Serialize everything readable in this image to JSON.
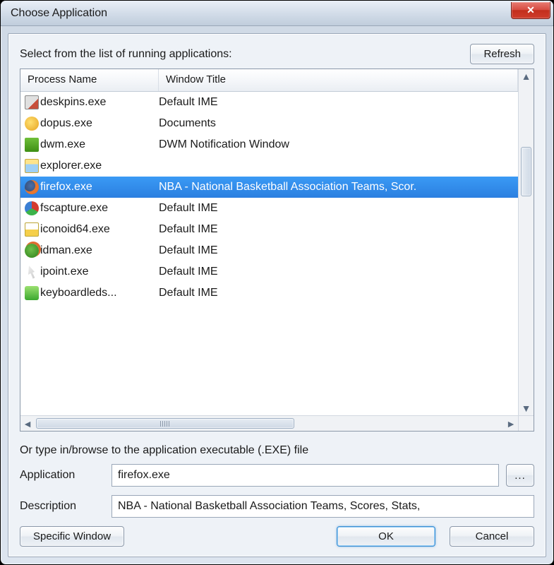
{
  "window": {
    "title": "Choose Application"
  },
  "instructions": {
    "top": "Select from the list of running applications:",
    "bottom": "Or type in/browse to the application executable (.EXE) file"
  },
  "buttons": {
    "refresh": "Refresh",
    "browse": "...",
    "specific_window": "Specific Window",
    "ok": "OK",
    "cancel": "Cancel",
    "close": "✕"
  },
  "columns": {
    "process": "Process Name",
    "title": "Window Title"
  },
  "labels": {
    "application": "Application",
    "description": "Description"
  },
  "fields": {
    "application_value": "firefox.exe",
    "description_value": "NBA - National Basketball Association Teams, Scores, Stats,"
  },
  "processes": [
    {
      "icon": "deskpins",
      "name": "deskpins.exe",
      "title": "Default IME",
      "selected": false
    },
    {
      "icon": "dopus",
      "name": "dopus.exe",
      "title": "Documents",
      "selected": false
    },
    {
      "icon": "dwm",
      "name": "dwm.exe",
      "title": "DWM Notification Window",
      "selected": false
    },
    {
      "icon": "explorer",
      "name": "explorer.exe",
      "title": "",
      "selected": false
    },
    {
      "icon": "firefox",
      "name": "firefox.exe",
      "title": "NBA - National Basketball Association Teams, Scor.",
      "selected": true
    },
    {
      "icon": "fscapture",
      "name": "fscapture.exe",
      "title": "Default IME",
      "selected": false
    },
    {
      "icon": "iconoid",
      "name": "iconoid64.exe",
      "title": "Default IME",
      "selected": false
    },
    {
      "icon": "idman",
      "name": "idman.exe",
      "title": "Default IME",
      "selected": false
    },
    {
      "icon": "ipoint",
      "name": "ipoint.exe",
      "title": "Default IME",
      "selected": false
    },
    {
      "icon": "keyboardleds",
      "name": "keyboardleds...",
      "title": "Default IME",
      "selected": false
    }
  ]
}
